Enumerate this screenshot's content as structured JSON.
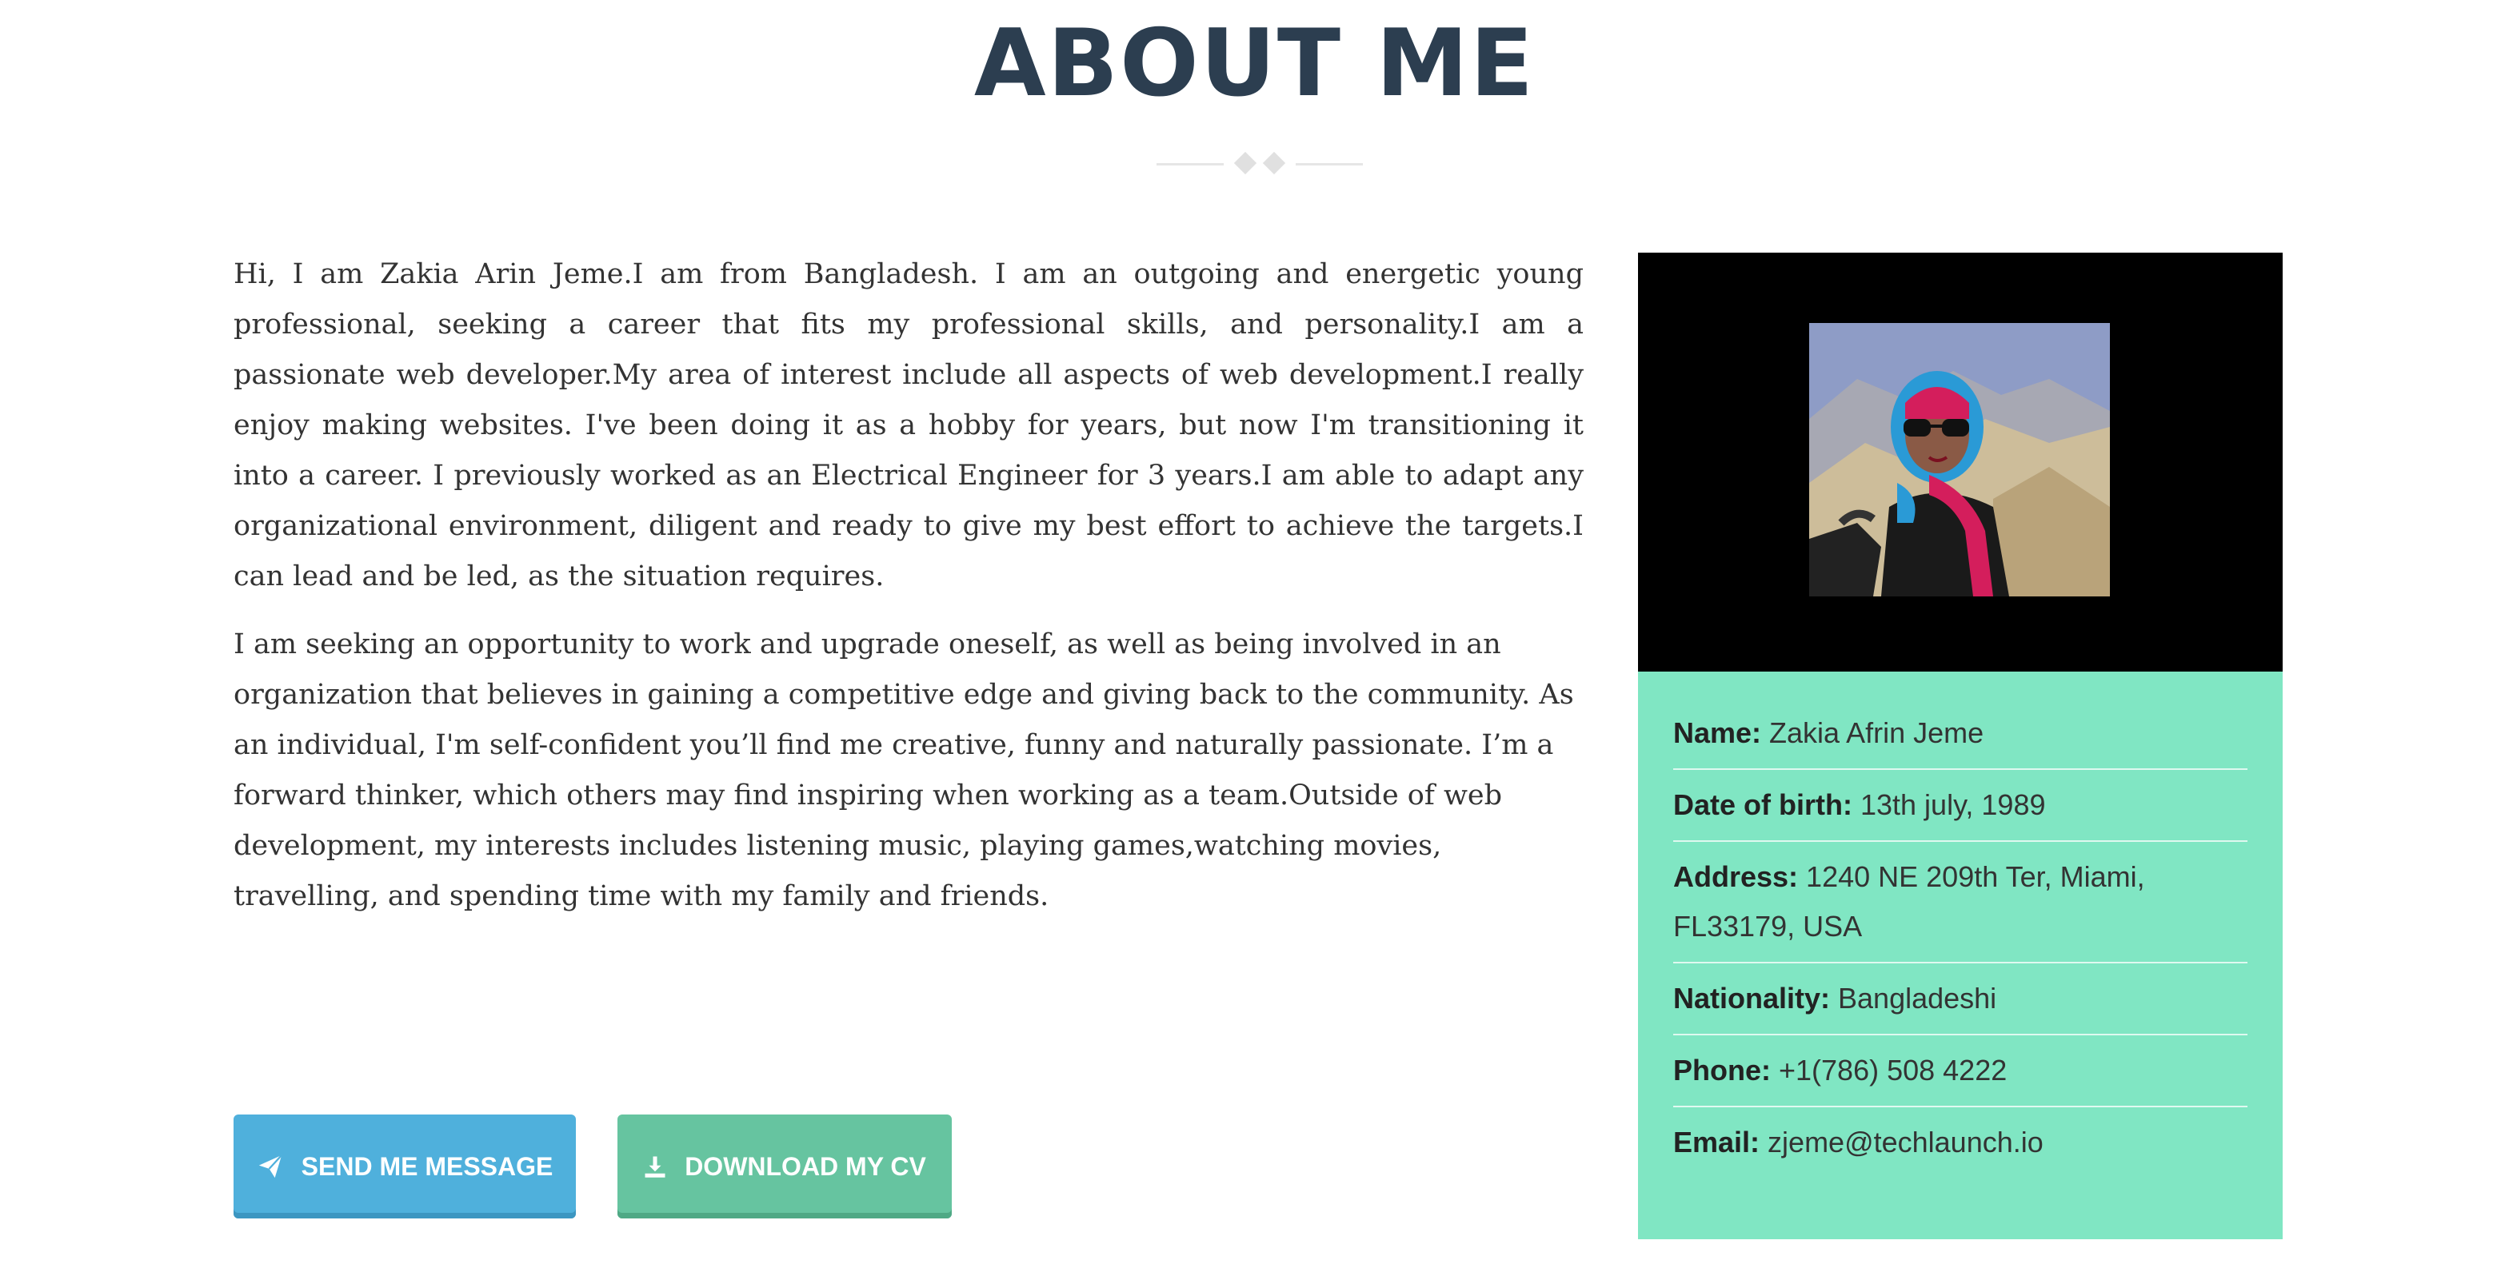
{
  "header": {
    "title": "ABOUT ME"
  },
  "bio": {
    "paragraph1": "Hi, I am Zakia Arin Jeme.I am from Bangladesh. I am an outgoing and energetic young professional, seeking a career that fits my professional skills, and personality.I am a passionate web developer.My area of interest include all aspects of web development.I really enjoy making websites. I've been doing it as a hobby for years, but now I'm transitioning it into a career. I previously worked as an Electrical Engineer for 3 years.I am able to adapt any organizational environment, diligent and ready to give my best effort to achieve the targets.I can lead and be led, as the situation requires.",
    "paragraph2": "I am seeking an opportunity to work and upgrade oneself, as well as being involved in an organization that believes in gaining a competitive edge and giving back to the community. As an individual, I'm self-confident you’ll find me creative, funny and naturally passionate. I’m a forward thinker, which others may find inspiring when working as a team.Outside of web development, my interests includes listening music, playing games,watching movies, travelling, and spending time with my family and friends."
  },
  "buttons": {
    "message": {
      "label": "SEND ME MESSAGE",
      "icon": "paper-plane-icon",
      "color": "#4fb0dc"
    },
    "cv": {
      "label": "DOWNLOAD MY CV",
      "icon": "download-icon",
      "color": "#66c4a0"
    }
  },
  "profile": {
    "photo": "profile-photo",
    "panel_color": "#80e6c3",
    "details": {
      "name": {
        "label": "Name:",
        "value": "Zakia Afrin Jeme"
      },
      "dob": {
        "label": "Date of birth:",
        "value": "13th july, 1989"
      },
      "address": {
        "label": "Address:",
        "value": "1240 NE 209th Ter, Miami, FL33179, USA"
      },
      "nationality": {
        "label": "Nationality:",
        "value": "Bangladeshi"
      },
      "phone": {
        "label": "Phone:",
        "value": "+1(786) 508 4222"
      },
      "email": {
        "label": "Email:",
        "value": "zjeme@techlaunch.io"
      }
    }
  }
}
